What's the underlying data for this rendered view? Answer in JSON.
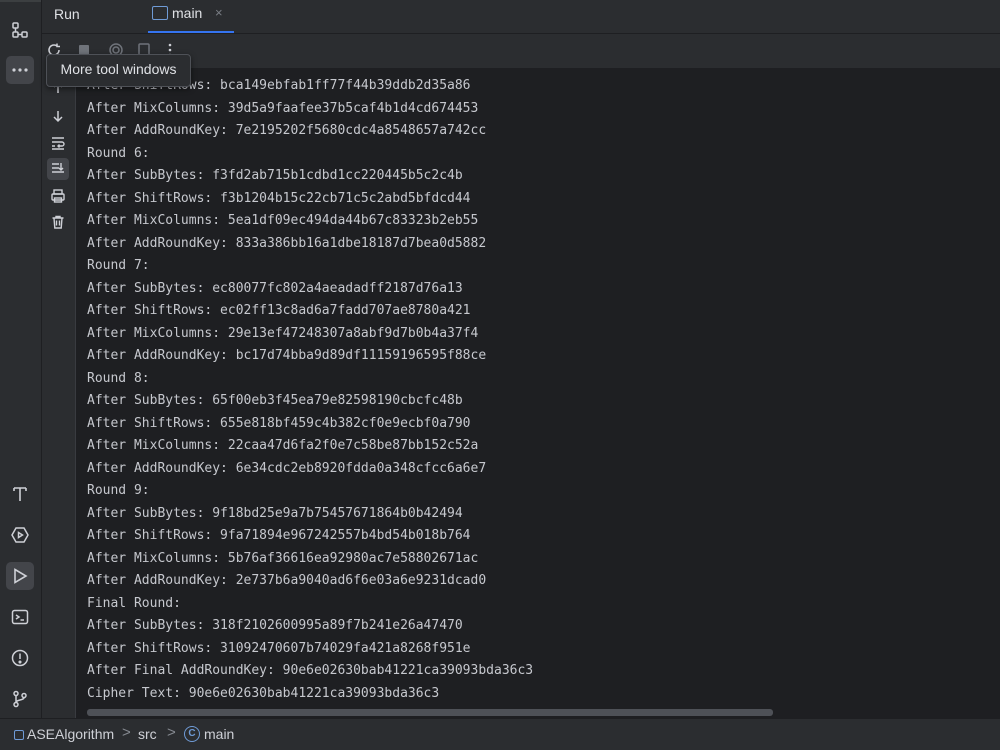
{
  "tool_window": {
    "title": "Run",
    "tab": {
      "label": "main",
      "close_glyph": "×"
    }
  },
  "tooltip": {
    "text": "More tool windows"
  },
  "left_strip": {
    "items": [
      {
        "icon": "structure-icon"
      },
      {
        "icon": "more-tool-windows-icon"
      },
      {
        "icon": "typography-icon"
      },
      {
        "icon": "services-icon"
      },
      {
        "icon": "run-icon"
      },
      {
        "icon": "terminal-icon"
      },
      {
        "icon": "problems-icon"
      },
      {
        "icon": "git-icon"
      }
    ]
  },
  "side_tools": [
    {
      "icon": "scroll-up-icon"
    },
    {
      "icon": "scroll-down-icon"
    },
    {
      "icon": "soft-wrap-icon"
    },
    {
      "icon": "scroll-to-end-icon"
    },
    {
      "icon": "print-icon"
    },
    {
      "icon": "clear-all-icon"
    }
  ],
  "console": {
    "lines": [
      "After ShiftRows: bca149ebfab1ff77f44b39ddb2d35a86",
      "After MixColumns: 39d5a9faafee37b5caf4b1d4cd674453",
      "After AddRoundKey: 7e2195202f5680cdc4a8548657a742cc",
      "Round 6:",
      "After SubBytes: f3fd2ab715b1cdbd1cc220445b5c2c4b",
      "After ShiftRows: f3b1204b15c22cb71c5c2abd5bfdcd44",
      "After MixColumns: 5ea1df09ec494da44b67c83323b2eb55",
      "After AddRoundKey: 833a386bb16a1dbe18187d7bea0d5882",
      "Round 7:",
      "After SubBytes: ec80077fc802a4aeadadff2187d76a13",
      "After ShiftRows: ec02ff13c8ad6a7fadd707ae8780a421",
      "After MixColumns: 29e13ef47248307a8abf9d7b0b4a37f4",
      "After AddRoundKey: bc17d74bba9d89df11159196595f88ce",
      "Round 8:",
      "After SubBytes: 65f00eb3f45ea79e82598190cbcfc48b",
      "After ShiftRows: 655e818bf459c4b382cf0e9ecbf0a790",
      "After MixColumns: 22caa47d6fa2f0e7c58be87bb152c52a",
      "After AddRoundKey: 6e34cdc2eb8920fdda0a348cfcc6a6e7",
      "Round 9:",
      "After SubBytes: 9f18bd25e9a7b75457671864b0b42494",
      "After ShiftRows: 9fa71894e967242557b4bd54b018b764",
      "After MixColumns: 5b76af36616ea92980ac7e58802671ac",
      "After AddRoundKey: 2e737b6a9040ad6f6e03a6e9231dcad0",
      "Final Round:",
      "After SubBytes: 318f2102600995a89f7b241e26a47470",
      "After ShiftRows: 31092470607b74029fa421a8268f951e",
      "After Final AddRoundKey: 90e6e02630bab41221ca39093bda36c3",
      "Cipher Text: 90e6e02630bab41221ca39093bda36c3"
    ]
  },
  "breadcrumb": {
    "project": "ASEAlgorithm",
    "folder": "src",
    "file": "main",
    "separator": ">",
    "class_glyph": "C"
  },
  "colors": {
    "accent": "#3574f0",
    "background": "#1e1f22",
    "panel": "#2b2d30",
    "text": "#c6c8ce"
  }
}
